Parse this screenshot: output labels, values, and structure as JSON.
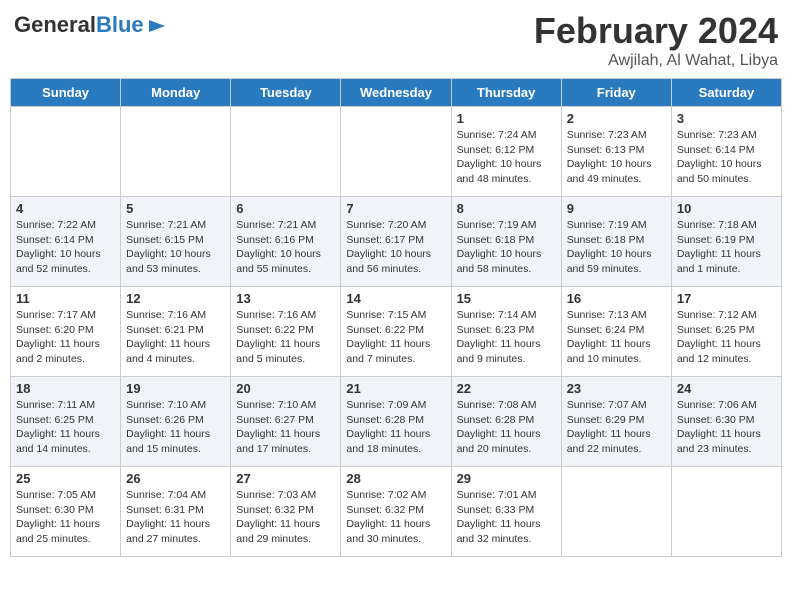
{
  "header": {
    "logo_general": "General",
    "logo_blue": "Blue",
    "month_title": "February 2024",
    "location": "Awjilah, Al Wahat, Libya"
  },
  "days_of_week": [
    "Sunday",
    "Monday",
    "Tuesday",
    "Wednesday",
    "Thursday",
    "Friday",
    "Saturday"
  ],
  "weeks": [
    [
      {
        "day": "",
        "info": ""
      },
      {
        "day": "",
        "info": ""
      },
      {
        "day": "",
        "info": ""
      },
      {
        "day": "",
        "info": ""
      },
      {
        "day": "1",
        "info": "Sunrise: 7:24 AM\nSunset: 6:12 PM\nDaylight: 10 hours\nand 48 minutes."
      },
      {
        "day": "2",
        "info": "Sunrise: 7:23 AM\nSunset: 6:13 PM\nDaylight: 10 hours\nand 49 minutes."
      },
      {
        "day": "3",
        "info": "Sunrise: 7:23 AM\nSunset: 6:14 PM\nDaylight: 10 hours\nand 50 minutes."
      }
    ],
    [
      {
        "day": "4",
        "info": "Sunrise: 7:22 AM\nSunset: 6:14 PM\nDaylight: 10 hours\nand 52 minutes."
      },
      {
        "day": "5",
        "info": "Sunrise: 7:21 AM\nSunset: 6:15 PM\nDaylight: 10 hours\nand 53 minutes."
      },
      {
        "day": "6",
        "info": "Sunrise: 7:21 AM\nSunset: 6:16 PM\nDaylight: 10 hours\nand 55 minutes."
      },
      {
        "day": "7",
        "info": "Sunrise: 7:20 AM\nSunset: 6:17 PM\nDaylight: 10 hours\nand 56 minutes."
      },
      {
        "day": "8",
        "info": "Sunrise: 7:19 AM\nSunset: 6:18 PM\nDaylight: 10 hours\nand 58 minutes."
      },
      {
        "day": "9",
        "info": "Sunrise: 7:19 AM\nSunset: 6:18 PM\nDaylight: 10 hours\nand 59 minutes."
      },
      {
        "day": "10",
        "info": "Sunrise: 7:18 AM\nSunset: 6:19 PM\nDaylight: 11 hours\nand 1 minute."
      }
    ],
    [
      {
        "day": "11",
        "info": "Sunrise: 7:17 AM\nSunset: 6:20 PM\nDaylight: 11 hours\nand 2 minutes."
      },
      {
        "day": "12",
        "info": "Sunrise: 7:16 AM\nSunset: 6:21 PM\nDaylight: 11 hours\nand 4 minutes."
      },
      {
        "day": "13",
        "info": "Sunrise: 7:16 AM\nSunset: 6:22 PM\nDaylight: 11 hours\nand 5 minutes."
      },
      {
        "day": "14",
        "info": "Sunrise: 7:15 AM\nSunset: 6:22 PM\nDaylight: 11 hours\nand 7 minutes."
      },
      {
        "day": "15",
        "info": "Sunrise: 7:14 AM\nSunset: 6:23 PM\nDaylight: 11 hours\nand 9 minutes."
      },
      {
        "day": "16",
        "info": "Sunrise: 7:13 AM\nSunset: 6:24 PM\nDaylight: 11 hours\nand 10 minutes."
      },
      {
        "day": "17",
        "info": "Sunrise: 7:12 AM\nSunset: 6:25 PM\nDaylight: 11 hours\nand 12 minutes."
      }
    ],
    [
      {
        "day": "18",
        "info": "Sunrise: 7:11 AM\nSunset: 6:25 PM\nDaylight: 11 hours\nand 14 minutes."
      },
      {
        "day": "19",
        "info": "Sunrise: 7:10 AM\nSunset: 6:26 PM\nDaylight: 11 hours\nand 15 minutes."
      },
      {
        "day": "20",
        "info": "Sunrise: 7:10 AM\nSunset: 6:27 PM\nDaylight: 11 hours\nand 17 minutes."
      },
      {
        "day": "21",
        "info": "Sunrise: 7:09 AM\nSunset: 6:28 PM\nDaylight: 11 hours\nand 18 minutes."
      },
      {
        "day": "22",
        "info": "Sunrise: 7:08 AM\nSunset: 6:28 PM\nDaylight: 11 hours\nand 20 minutes."
      },
      {
        "day": "23",
        "info": "Sunrise: 7:07 AM\nSunset: 6:29 PM\nDaylight: 11 hours\nand 22 minutes."
      },
      {
        "day": "24",
        "info": "Sunrise: 7:06 AM\nSunset: 6:30 PM\nDaylight: 11 hours\nand 23 minutes."
      }
    ],
    [
      {
        "day": "25",
        "info": "Sunrise: 7:05 AM\nSunset: 6:30 PM\nDaylight: 11 hours\nand 25 minutes."
      },
      {
        "day": "26",
        "info": "Sunrise: 7:04 AM\nSunset: 6:31 PM\nDaylight: 11 hours\nand 27 minutes."
      },
      {
        "day": "27",
        "info": "Sunrise: 7:03 AM\nSunset: 6:32 PM\nDaylight: 11 hours\nand 29 minutes."
      },
      {
        "day": "28",
        "info": "Sunrise: 7:02 AM\nSunset: 6:32 PM\nDaylight: 11 hours\nand 30 minutes."
      },
      {
        "day": "29",
        "info": "Sunrise: 7:01 AM\nSunset: 6:33 PM\nDaylight: 11 hours\nand 32 minutes."
      },
      {
        "day": "",
        "info": ""
      },
      {
        "day": "",
        "info": ""
      }
    ]
  ]
}
